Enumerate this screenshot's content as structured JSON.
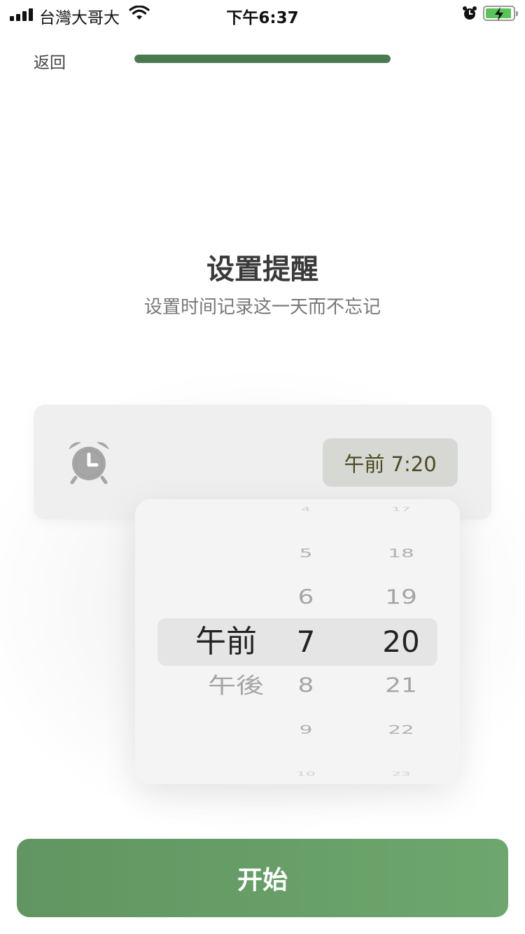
{
  "status_bar": {
    "carrier": "台灣大哥大",
    "time": "下午6:37",
    "battery_charging": true
  },
  "nav": {
    "back_label": "返回",
    "progress": 1.0,
    "progress_color": "#4a7a52"
  },
  "header": {
    "title": "设置提醒",
    "subtitle": "设置时间记录这一天而不忘记"
  },
  "reminder": {
    "icon": "alarm-clock-icon",
    "time_display": "午前 7:20"
  },
  "picker": {
    "period": {
      "items": [
        "午前",
        "午後"
      ],
      "selected_index": 0
    },
    "hour": {
      "items": [
        "4",
        "5",
        "6",
        "7",
        "8",
        "9",
        "10"
      ],
      "selected_index": 3
    },
    "minute": {
      "items": [
        "17",
        "18",
        "19",
        "20",
        "21",
        "22",
        "23"
      ],
      "selected_index": 3
    }
  },
  "start_button": {
    "label": "开始",
    "color": "#6aa06b"
  }
}
